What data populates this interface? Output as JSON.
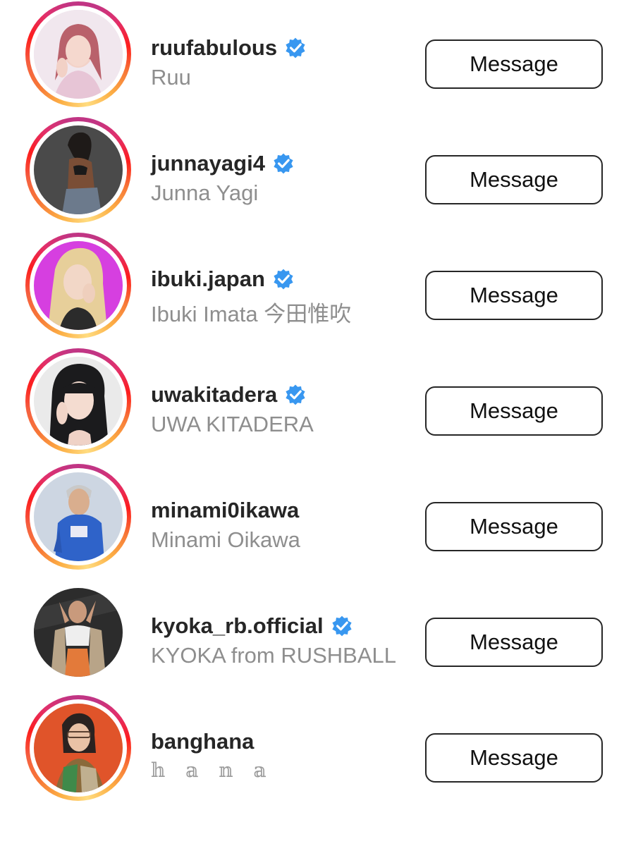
{
  "accent": {
    "verified_blue": "#3897f0",
    "story_ring": [
      "#fcaf45",
      "#fd1d1d",
      "#c13584"
    ],
    "secondary_text": "#8e8e8e"
  },
  "accounts": [
    {
      "username": "ruufabulous",
      "full_name": "Ruu",
      "verified": true,
      "story_ring": true,
      "button_label": "Message",
      "icon": "verified-badge-icon"
    },
    {
      "username": "junnayagi4",
      "full_name": "Junna Yagi",
      "verified": true,
      "story_ring": true,
      "button_label": "Message",
      "icon": "verified-badge-icon"
    },
    {
      "username": "ibuki.japan",
      "full_name": "Ibuki Imata 今田惟吹",
      "verified": true,
      "story_ring": true,
      "button_label": "Message",
      "icon": "verified-badge-icon"
    },
    {
      "username": "uwakitadera",
      "full_name": "UWA KITADERA",
      "verified": true,
      "story_ring": true,
      "button_label": "Message",
      "icon": "verified-badge-icon"
    },
    {
      "username": "minami0ikawa",
      "full_name": "Minami Oikawa",
      "verified": false,
      "story_ring": true,
      "button_label": "Message"
    },
    {
      "username": "kyoka_rb.official",
      "full_name": "KYOKA from RUSHBALL",
      "verified": true,
      "story_ring": false,
      "button_label": "Message",
      "icon": "verified-badge-icon"
    },
    {
      "username": "banghana",
      "full_name": "𝕙 𝕒 𝕟 𝕒",
      "verified": false,
      "story_ring": true,
      "button_label": "Message"
    }
  ]
}
